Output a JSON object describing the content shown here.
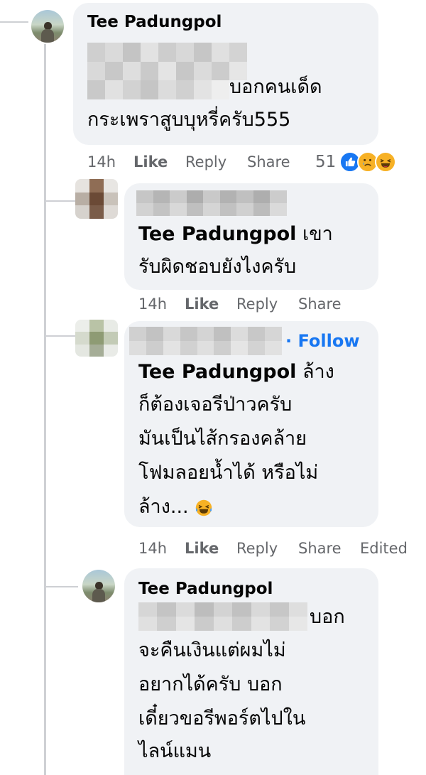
{
  "comments": [
    {
      "author": "Tee Padungpol",
      "lines": [
        "บอกคนเด็ด",
        "กระเพราสูบบุหรี่ครับ555"
      ],
      "time": "14h",
      "like": "Like",
      "reply": "Reply",
      "share": "Share",
      "reaction_count": "51",
      "reactions": [
        "like",
        "sad",
        "haha"
      ]
    },
    {
      "mention": "Tee Padungpol",
      "lines": [
        "เขา",
        "รับผิดชอบยังไงครับ"
      ],
      "time": "14h",
      "like": "Like",
      "reply": "Reply",
      "share": "Share"
    },
    {
      "follow": "Follow",
      "mention": "Tee Padungpol",
      "lines": [
        "ล้าง",
        "ก็ต้องเจอรีป่าวครับ",
        "มันเป็นไส้กรองคล้าย",
        "โฟมลอยน้ำได้ หรือไม่",
        "ล้าง..."
      ],
      "time": "14h",
      "like": "Like",
      "reply": "Reply",
      "share": "Share",
      "edited": "Edited"
    },
    {
      "author": "Tee Padungpol",
      "lines": [
        "บอก",
        "จะคืนเงินแต่ผมไม่",
        "อยากได้ครับ บอก",
        "เดี๋ยวขอรีพอร์ตไปใน",
        "ไลน์แมน"
      ]
    }
  ],
  "colors": {
    "bubble": "#f0f2f5",
    "meta_text": "#65676b",
    "follow_link": "#1877f2",
    "thread_line": "#ced0d4"
  },
  "icons": {
    "reaction_like": "thumbs-up-icon",
    "reaction_sad": "sad-face-icon",
    "reaction_haha": "laughing-face-icon",
    "inline_emoji": "laughing-crying-emoji"
  }
}
